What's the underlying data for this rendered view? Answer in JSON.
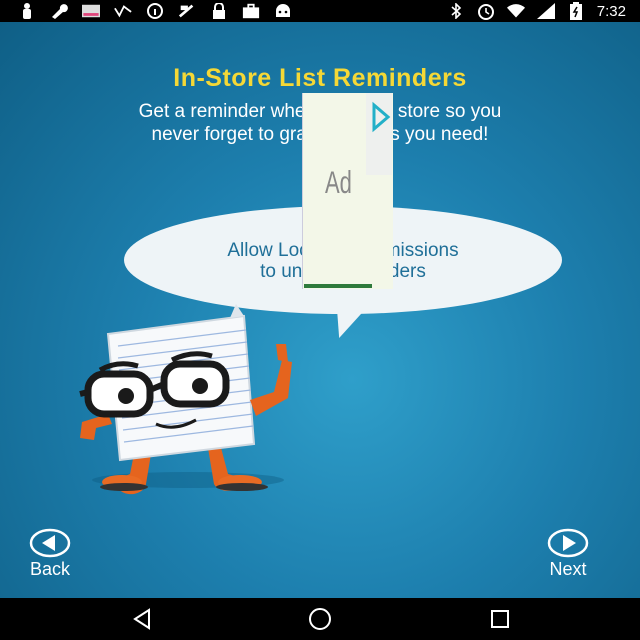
{
  "status_bar": {
    "time": "7:32",
    "left_icons": [
      "person-icon",
      "wrench-icon",
      "photo-icon",
      "signal-wave-icon",
      "info-icon",
      "fax-icon",
      "lock-icon",
      "briefcase-icon",
      "android-icon"
    ],
    "right_icons": [
      "bluetooth-icon",
      "alarm-icon",
      "wifi-icon",
      "cellular-icon",
      "battery-icon"
    ]
  },
  "screen": {
    "title": "In-Store List Reminders",
    "subtitle_line1": "Get a reminder when you're in store so you",
    "subtitle_line2": "never forget to grab the items you need!",
    "bubble_line1": "Allow Location Permissions",
    "bubble_line2": "to unlock reminders"
  },
  "ad": {
    "label": "Ad"
  },
  "navigation": {
    "back_label": "Back",
    "next_label": "Next"
  },
  "colors": {
    "title": "#f5d836",
    "background": "#1d7fae",
    "bubble_text": "#1f6f98"
  }
}
